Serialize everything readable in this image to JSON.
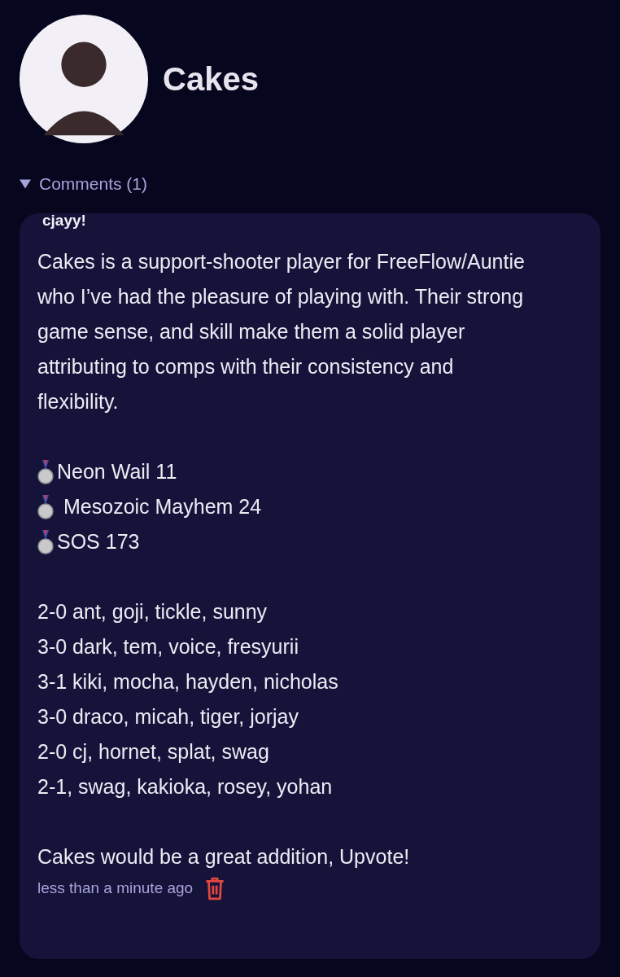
{
  "profile": {
    "name": "Cakes"
  },
  "comments_section": {
    "label": "Comments (1)",
    "expanded": true
  },
  "comments": [
    {
      "author": "cjayy!",
      "intro": "Cakes is a support-shooter player for FreeFlow/Auntie who I’ve had the pleasure of playing with. Their strong game sense, and skill make them a solid player attributing to comps with their consistency and flexibility.",
      "placements": [
        {
          "kind": "silver",
          "event": "Neon Wail 11"
        },
        {
          "kind": "silver",
          "event": "Mesozoic Mayhem 24"
        },
        {
          "kind": "silver",
          "event": "SOS 173"
        }
      ],
      "matches": [
        "2-0 ant, goji, tickle, sunny",
        "3-0 dark, tem, voice, fresyurii",
        "3-1 kiki, mocha, hayden, nicholas",
        "3-0 draco, micah, tiger, jorjay",
        "2-0 cj, hornet, splat, swag",
        "2-1, swag, kakioka, rosey, yohan"
      ],
      "closing": "Cakes would be a great addition, Upvote!",
      "time": "less than a minute ago"
    }
  ]
}
